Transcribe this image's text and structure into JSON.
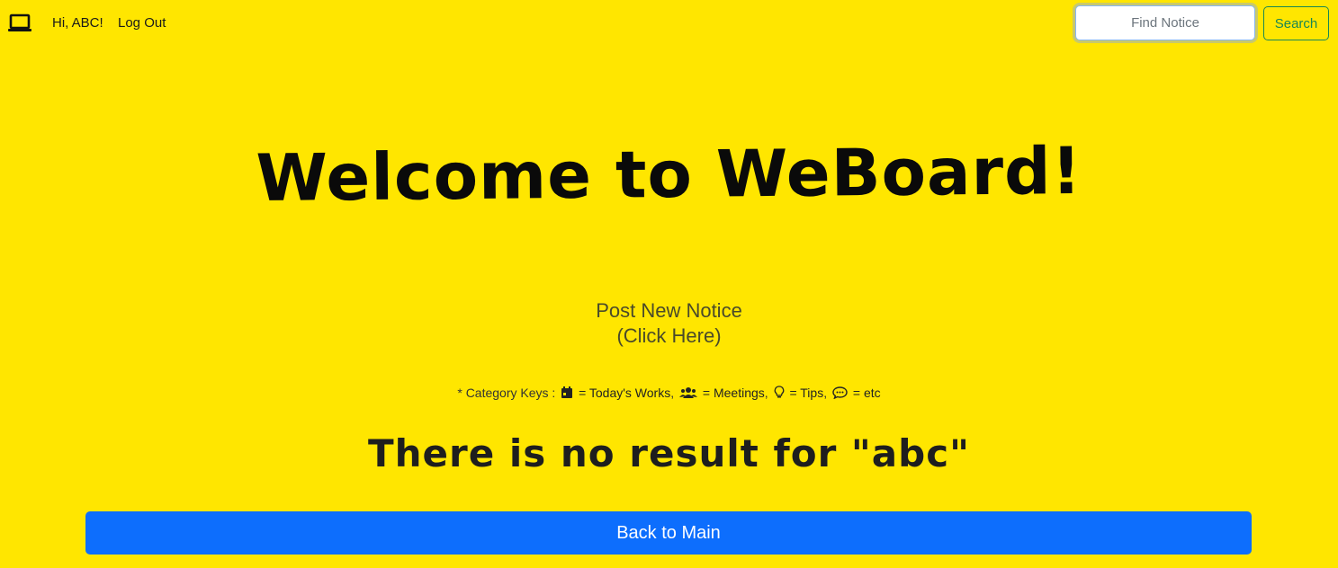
{
  "nav": {
    "logo_icon": "laptop-icon",
    "greeting": "Hi, ABC!",
    "logout_label": "Log Out"
  },
  "search": {
    "value": "",
    "placeholder": "Find Notice",
    "button_label": "Search"
  },
  "main": {
    "title": "Welcome to WeBoard!",
    "post_link_line1": "Post New Notice",
    "post_link_line2": "(Click Here)",
    "category_keys": {
      "prefix": "* Category Keys :",
      "items": [
        {
          "icon": "calendar-icon",
          "label": "= Today's Works"
        },
        {
          "icon": "users-icon",
          "label": "= Meetings"
        },
        {
          "icon": "lightbulb-icon",
          "label": "= Tips"
        },
        {
          "icon": "comment-icon",
          "label": "= etc"
        }
      ]
    },
    "no_result_text": "There is no result for \"abc\"",
    "back_button_label": "Back to Main"
  },
  "colors": {
    "background": "#ffe600",
    "primary_button": "#0d6efd",
    "search_button": "#198754"
  }
}
